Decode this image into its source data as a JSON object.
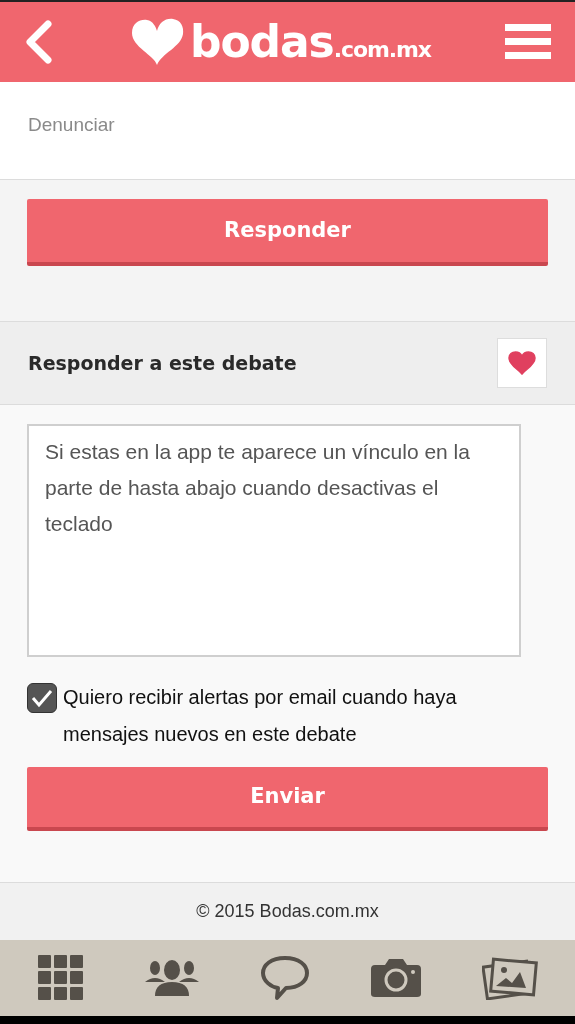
{
  "header": {
    "logo_main": "bodas",
    "logo_suffix": ".com.mx"
  },
  "report_link": "Denunciar",
  "reply_button": "Responder",
  "reply_section": {
    "title": "Responder a este debate",
    "favorite": true
  },
  "message": {
    "value": "Si estas en la app te aparece un vínculo en la parte de hasta abajo cuando desactivas el teclado"
  },
  "alerts": {
    "label": "Quiero recibir alertas por email cuando haya mensajes nuevos en este debate",
    "checked": true
  },
  "send_button": "Enviar",
  "footer": "© 2015 Bodas.com.mx",
  "bottom_nav": [
    {
      "kind": "grid"
    },
    {
      "kind": "people"
    },
    {
      "kind": "chat"
    },
    {
      "kind": "camera"
    },
    {
      "kind": "photos"
    }
  ]
}
